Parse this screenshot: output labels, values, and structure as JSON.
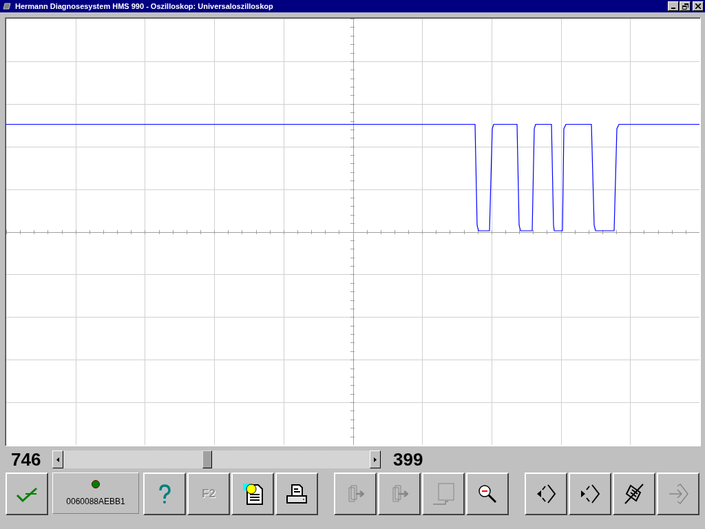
{
  "window": {
    "title": "Hermann Diagnosesystem HMS 990 - Oszilloskop: Universaloszilloskop"
  },
  "range": {
    "start": "746",
    "end": "399"
  },
  "toolbar_left": [
    {
      "kind": "confirm",
      "disabled": false
    },
    {
      "kind": "status",
      "disabled": false,
      "led_on": true,
      "text": "0060088AEBB1"
    },
    {
      "kind": "help",
      "disabled": false
    },
    {
      "kind": "key",
      "disabled": true,
      "text": "F2"
    },
    {
      "kind": "document",
      "disabled": false
    },
    {
      "kind": "print",
      "disabled": false
    }
  ],
  "toolbar_middle": [
    {
      "kind": "pages-next",
      "disabled": true
    },
    {
      "kind": "pages-forward",
      "disabled": true
    },
    {
      "kind": "page-back",
      "disabled": true
    },
    {
      "kind": "zoom-out",
      "disabled": false
    }
  ],
  "toolbar_right": [
    {
      "kind": "cursor-left",
      "disabled": false
    },
    {
      "kind": "cursor-right",
      "disabled": false
    },
    {
      "kind": "cursor-hold",
      "disabled": false
    },
    {
      "kind": "exit",
      "disabled": true
    }
  ]
}
